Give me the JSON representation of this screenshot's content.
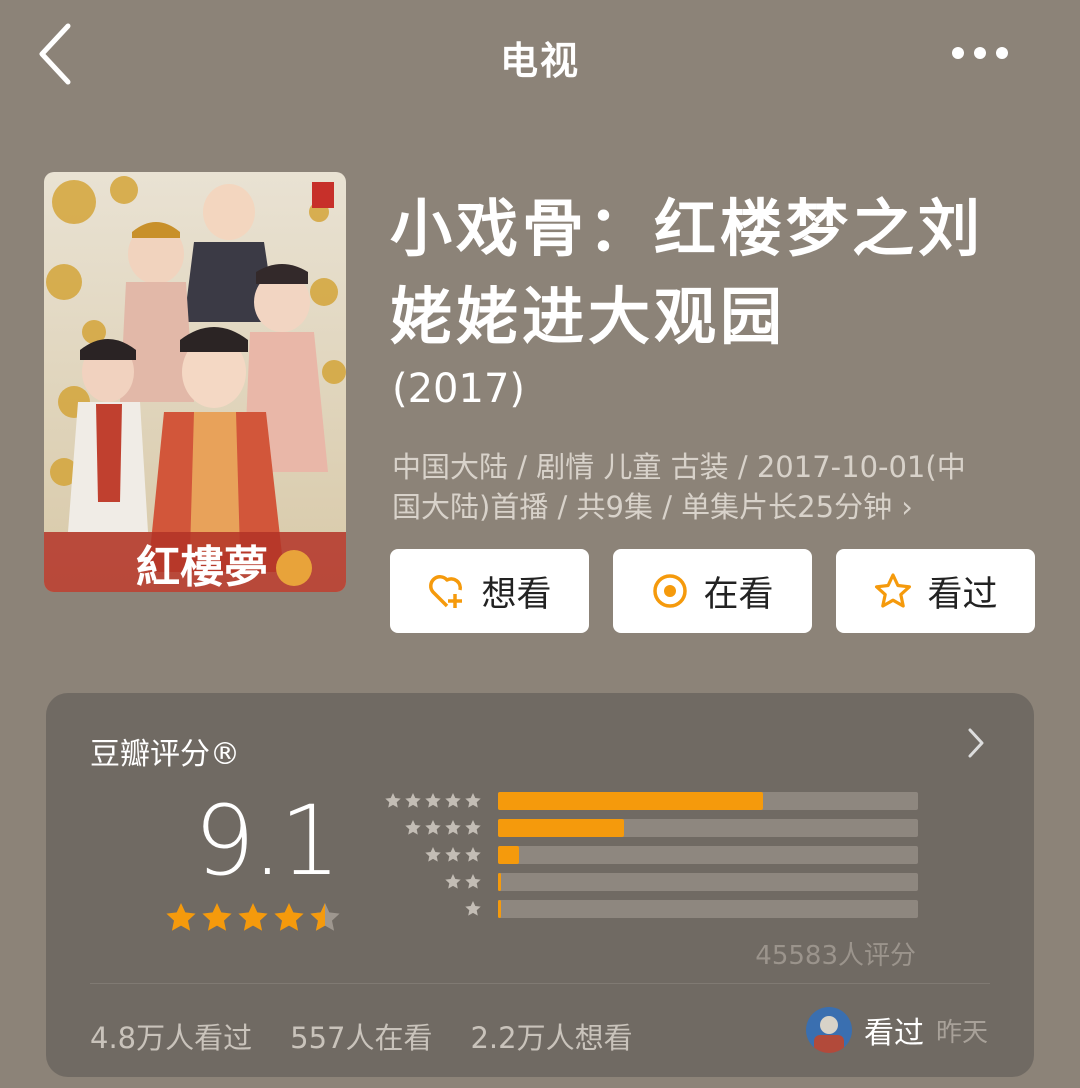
{
  "nav": {
    "title": "电视"
  },
  "movie": {
    "title": "小戏骨：红楼梦之刘姥姥进大观园",
    "year": "(2017)",
    "meta_line1": "中国大陆 / 剧情 儿童 古装 / 2017-10-01(中",
    "meta_line2": "国大陆)首播 / 共9集 / 单集片长25分钟 ›"
  },
  "actions": {
    "want": "想看",
    "watching": "在看",
    "watched": "看过"
  },
  "rating": {
    "header": "豆瓣评分®",
    "score": "9.1",
    "stars": 4.5,
    "distribution": [
      {
        "stars": 5,
        "percent": 63
      },
      {
        "stars": 4,
        "percent": 30
      },
      {
        "stars": 3,
        "percent": 5
      },
      {
        "stars": 2,
        "percent": 0.6
      },
      {
        "stars": 1,
        "percent": 0.6
      }
    ],
    "count": "45583人评分"
  },
  "stats": {
    "watched": "4.8万人看过",
    "watching": "557人在看",
    "want": "2.2万人想看"
  },
  "friend": {
    "status": "看过",
    "time": "昨天"
  },
  "colors": {
    "accent": "#f59a0c",
    "background": "#8c8378",
    "card": "#706a63"
  }
}
